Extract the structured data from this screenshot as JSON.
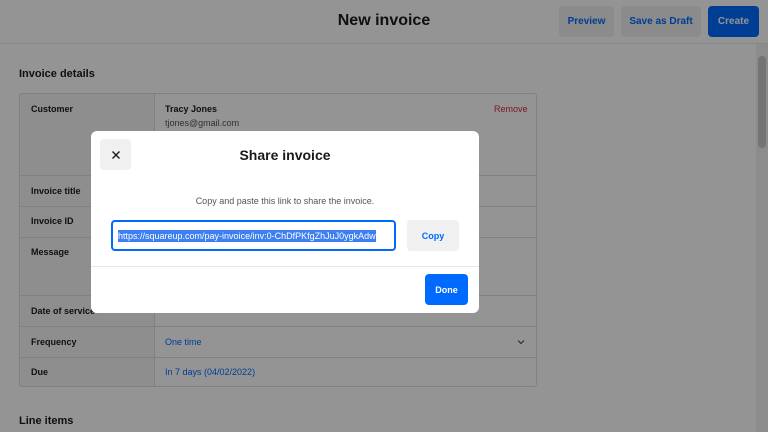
{
  "header": {
    "title": "New invoice",
    "preview_label": "Preview",
    "save_draft_label": "Save as Draft",
    "create_label": "Create"
  },
  "invoice_details": {
    "section_title": "Invoice details",
    "customer": {
      "label": "Customer",
      "name": "Tracy Jones",
      "email": "tjones@gmail.com",
      "remove_label": "Remove"
    },
    "rows": {
      "invoice_title_label": "Invoice title",
      "invoice_id_label": "Invoice ID",
      "message_label": "Message",
      "date_of_service_label": "Date of service",
      "frequency_label": "Frequency",
      "frequency_value": "One time",
      "due_label": "Due",
      "due_value": "In 7 days (04/02/2022)"
    }
  },
  "line_items": {
    "section_title": "Line items"
  },
  "modal": {
    "title": "Share invoice",
    "description": "Copy and paste this link to share the invoice.",
    "link": "https://squareup.com/pay-invoice/inv:0-ChDfPKfgZhJuJ0ygkAdw",
    "copy_label": "Copy",
    "done_label": "Done"
  },
  "colors": {
    "accent": "#006aff",
    "danger": "#d42a3c",
    "overlay": "rgba(0,0,0,0.42)"
  },
  "icons": {
    "close": "close-icon",
    "chevron": "chevron-down-icon"
  }
}
